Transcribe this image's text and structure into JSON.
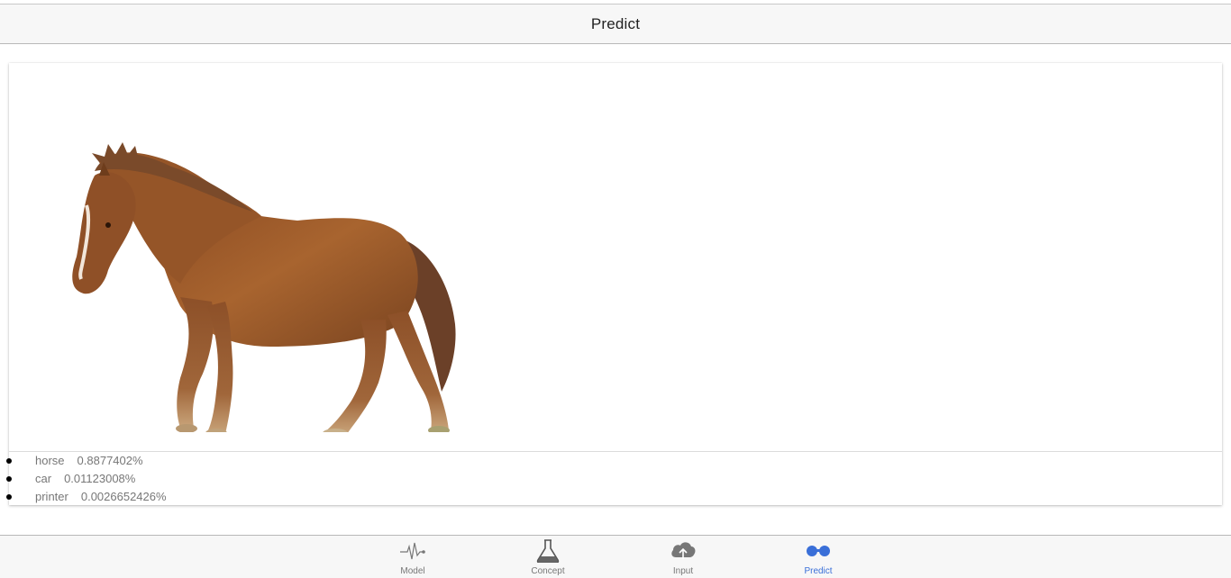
{
  "header": {
    "title": "Predict"
  },
  "predictions": [
    {
      "label": "horse",
      "score": "0.8877402%"
    },
    {
      "label": "car",
      "score": "0.01123008%"
    },
    {
      "label": "printer",
      "score": "0.0026652426%"
    }
  ],
  "tabs": [
    {
      "label": "Model",
      "icon": "heartbeat-icon"
    },
    {
      "label": "Concept",
      "icon": "flask-icon"
    },
    {
      "label": "Input",
      "icon": "cloud-upload-icon"
    },
    {
      "label": "Predict",
      "icon": "binoculars-icon",
      "active": true
    }
  ],
  "colors": {
    "accent": "#3a6fd8",
    "horse_body": "#9a5a2a"
  }
}
